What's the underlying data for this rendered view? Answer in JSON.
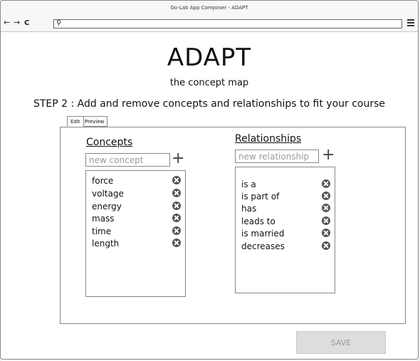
{
  "window": {
    "title": "Go-Lab App Composer - ADAPT"
  },
  "toolbar": {
    "back_glyph": "←",
    "forward_glyph": "→",
    "reload_glyph": "C",
    "search_glyph": "⚲",
    "url_value": ""
  },
  "header": {
    "title": "ADAPT",
    "subtitle": "the concept map",
    "step": "STEP 2 : Add and remove concepts and relationships to fit your course"
  },
  "tabs": [
    {
      "label": "Edit",
      "active": true
    },
    {
      "label": "Preview",
      "active": false
    }
  ],
  "concepts": {
    "title": "Concepts",
    "placeholder": "new concept",
    "add_label": "+",
    "items": [
      "force",
      "voltage",
      "energy",
      "mass",
      "time",
      "length"
    ]
  },
  "relationships": {
    "title": "Relationships",
    "placeholder": "new relationship",
    "add_label": "+",
    "items": [
      "is a",
      "is part of",
      "has",
      "leads to",
      "is married",
      "decreases"
    ]
  },
  "actions": {
    "save_label": "SAVE"
  },
  "icons": {
    "remove": "remove-circle-icon",
    "menu": "hamburger-menu-icon"
  },
  "colors": {
    "icon": "#555555",
    "save_bg": "#dddddd",
    "save_text": "#999999"
  }
}
